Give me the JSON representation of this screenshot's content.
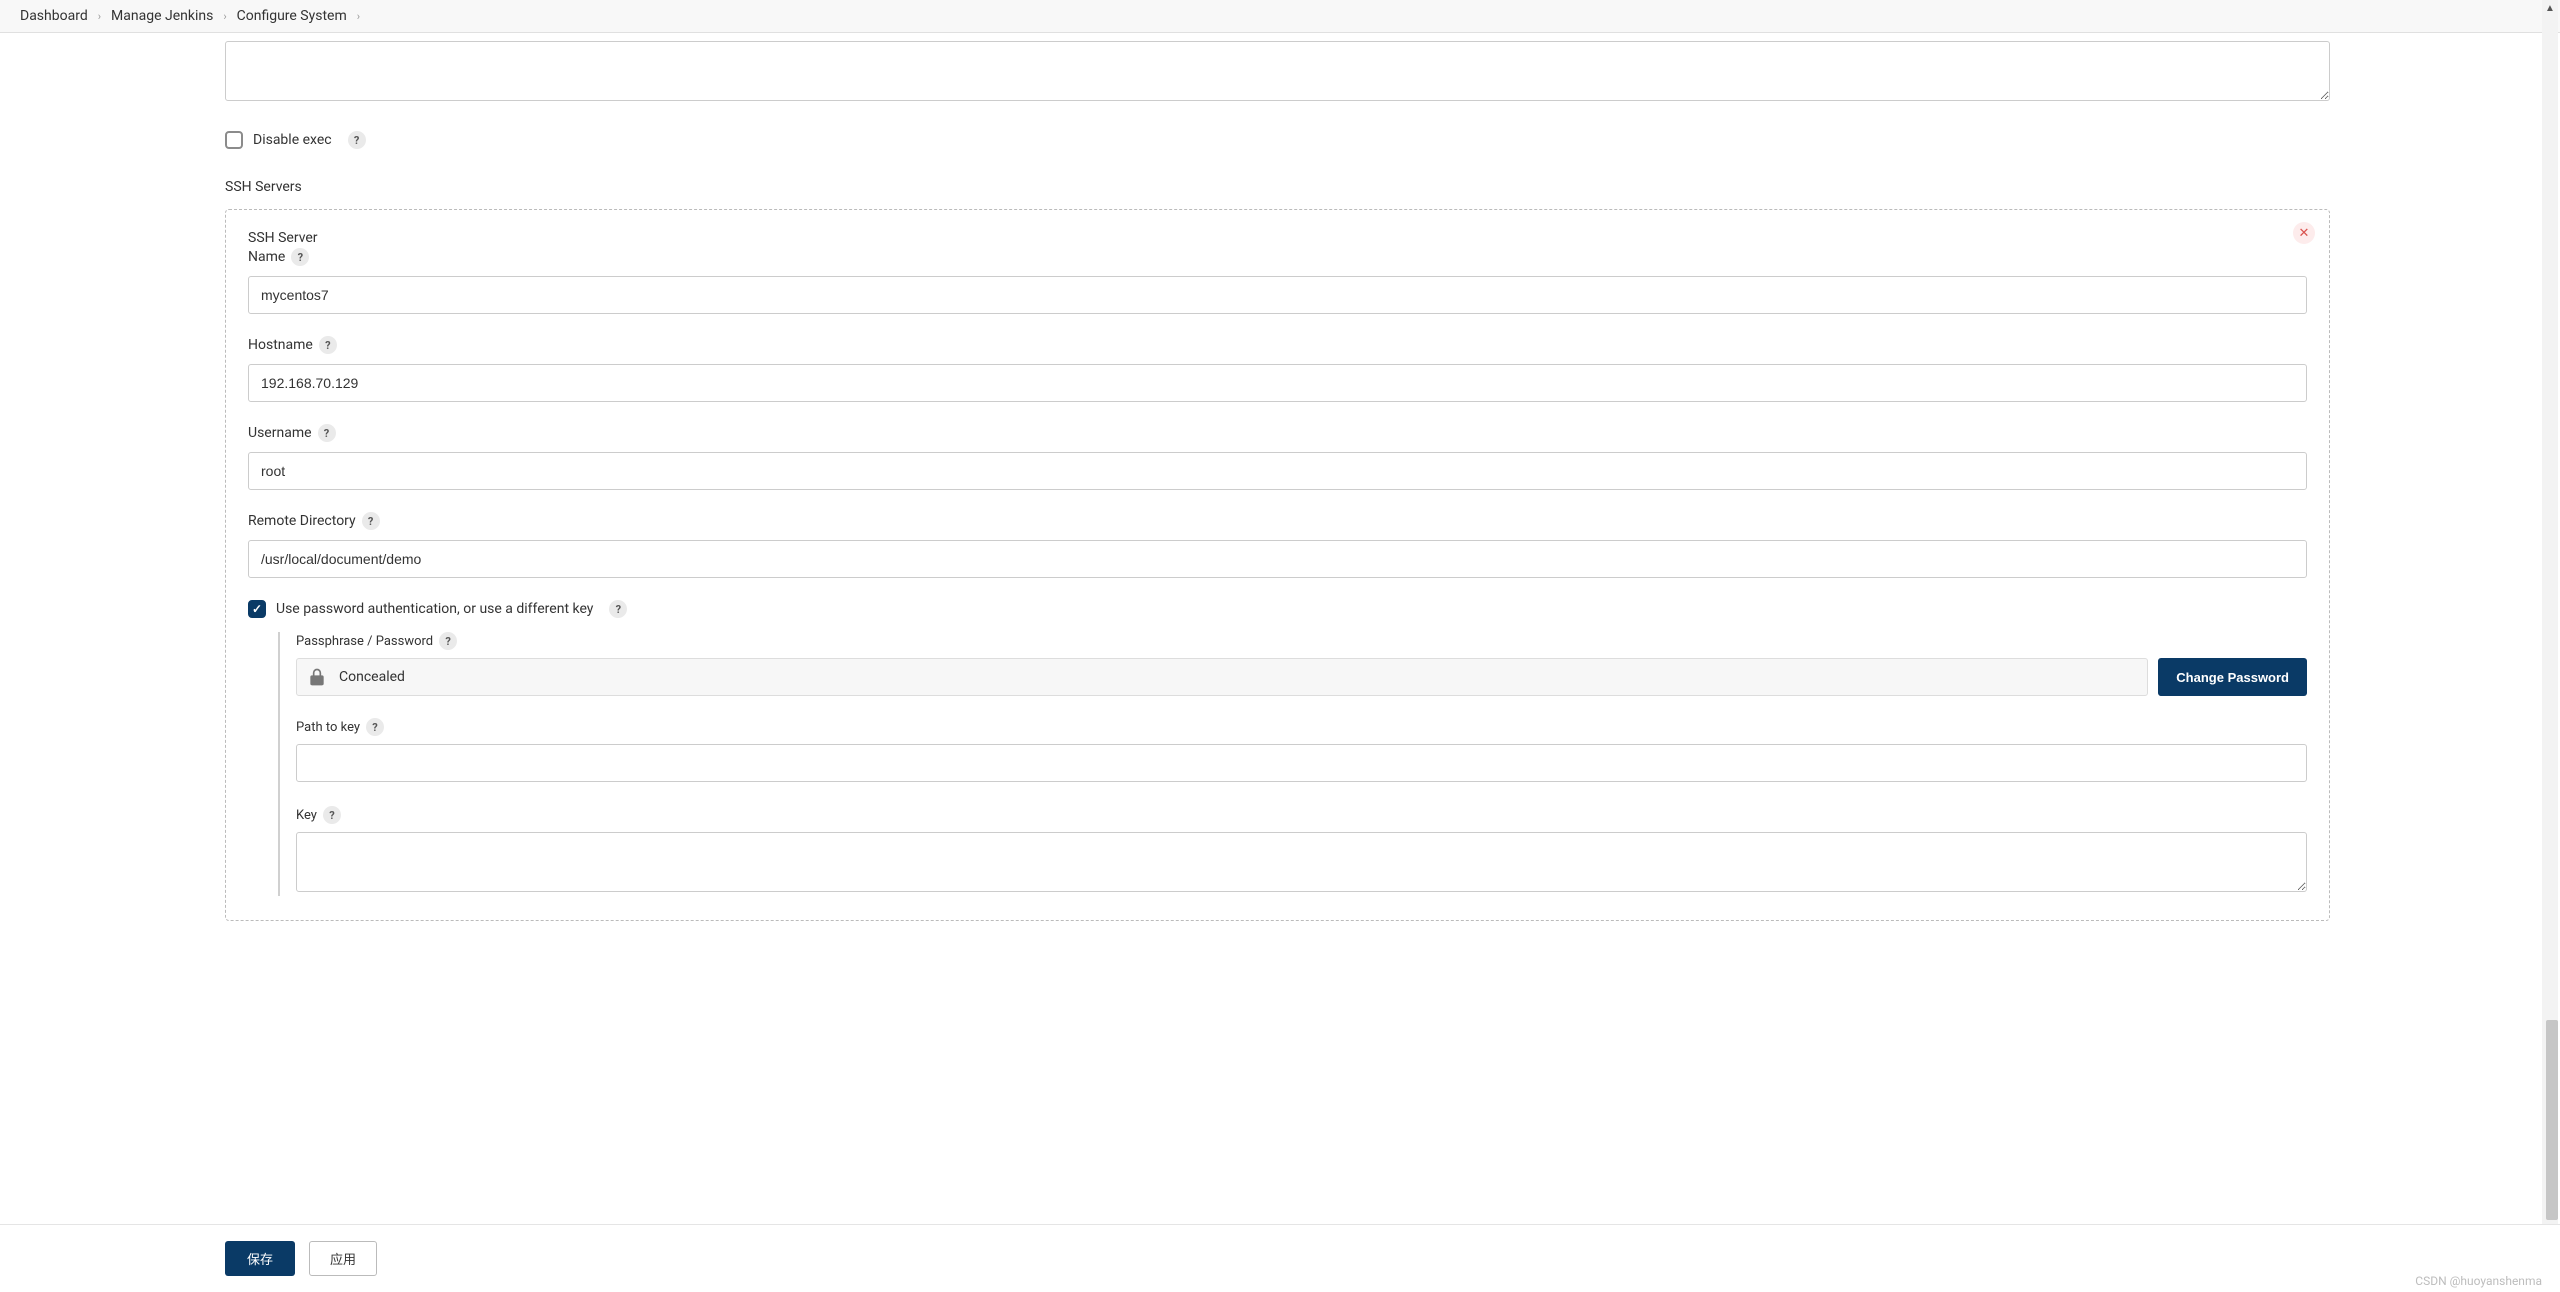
{
  "breadcrumb": {
    "items": [
      "Dashboard",
      "Manage Jenkins",
      "Configure System"
    ]
  },
  "disableExec": {
    "label": "Disable exec",
    "checked": false
  },
  "sshServersHeading": "SSH Servers",
  "sshServer": {
    "title": "SSH Server",
    "name": {
      "label": "Name",
      "value": "mycentos7"
    },
    "hostname": {
      "label": "Hostname",
      "value": "192.168.70.129"
    },
    "username": {
      "label": "Username",
      "value": "root"
    },
    "remoteDirectory": {
      "label": "Remote Directory",
      "value": "/usr/local/document/demo"
    },
    "usePasswordAuth": {
      "label": "Use password authentication, or use a different key",
      "checked": true
    },
    "passphrase": {
      "label": "Passphrase / Password",
      "concealed": "Concealed",
      "changeBtn": "Change Password"
    },
    "pathToKey": {
      "label": "Path to key",
      "value": ""
    },
    "key": {
      "label": "Key",
      "value": ""
    }
  },
  "footer": {
    "save": "保存",
    "apply": "应用"
  },
  "helpGlyph": "?",
  "watermark": "CSDN @huoyanshenma"
}
